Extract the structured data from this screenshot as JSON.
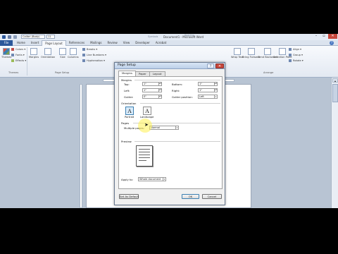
{
  "titlebar": {
    "font_name": "Calibri (Body)",
    "font_size": "11",
    "ghost_left": "Symbols",
    "ghost_right": "Spacing",
    "window_title": "Document1 - Microsoft Word",
    "min": "–",
    "max": "▫",
    "close": "✕"
  },
  "ribbon": {
    "file_tab": "File",
    "tabs": [
      "Home",
      "Insert",
      "Page Layout",
      "References",
      "Mailings",
      "Review",
      "View",
      "Developer",
      "Acrobat"
    ],
    "active_tab": "Page Layout",
    "help": "?",
    "themes": {
      "themes": "Themes",
      "colors": "Colors ▾",
      "fonts": "Fonts ▾",
      "effects": "Effects ▾",
      "group": "Themes"
    },
    "page_setup": {
      "margins": "Margins",
      "orientation": "Orientation",
      "size": "Size",
      "columns": "Columns",
      "breaks": "Breaks ▾",
      "line_numbers": "Line Numbers ▾",
      "hyphenation": "Hyphenation ▾",
      "group": "Page Setup"
    },
    "arrange": {
      "wrap_text": "Wrap Text",
      "bring_forward": "Bring Forward",
      "send_backward": "Send Backward",
      "selection_pane": "Selection Pane",
      "align": "Align ▾",
      "group_btn": "Group ▾",
      "rotate": "Rotate ▾",
      "group": "Arrange"
    }
  },
  "dialog": {
    "title": "Page Setup",
    "help": "?",
    "close": "✕",
    "tabs": [
      "Margins",
      "Paper",
      "Layout"
    ],
    "margins_section": "Margins",
    "fields": {
      "top_label": "Top:",
      "top_value": "1\"",
      "bottom_label": "Bottom:",
      "bottom_value": "1\"",
      "left_label": "Left:",
      "left_value": "1\"",
      "right_label": "Right:",
      "right_value": "1\"",
      "gutter_label": "Gutter:",
      "gutter_value": "0\"",
      "gutter_pos_label": "Gutter position:",
      "gutter_pos_value": "Left"
    },
    "orientation_section": "Orientation",
    "portrait": "Portrait",
    "landscape": "Landscape",
    "pages_section": "Pages",
    "multiple_pages_label": "Multiple pages:",
    "multiple_pages_value": "Normal",
    "preview_section": "Preview",
    "apply_to_label": "Apply to:",
    "apply_to_value": "Whole document",
    "set_default": "Set As Default",
    "ok": "OK",
    "cancel": "Cancel"
  },
  "colors": {
    "file_tab": "#2b579a",
    "close_red": "#c7463b",
    "highlight": "#fff050"
  }
}
